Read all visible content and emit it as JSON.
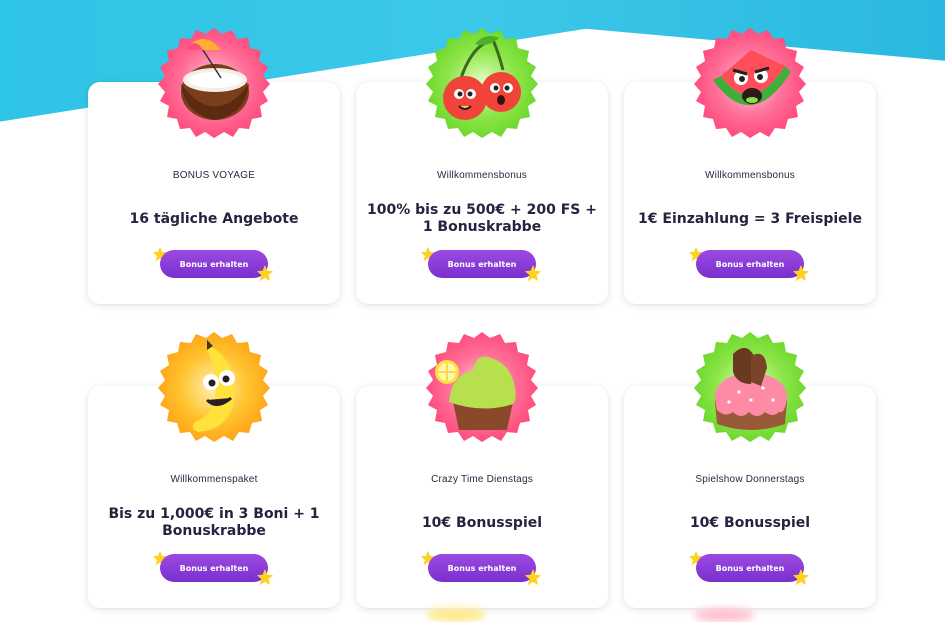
{
  "colors": {
    "sky": "#2ec4e6",
    "button": "#8a3cd8",
    "title_text": "#2a2140",
    "star": "#ffd21f",
    "badge_pink": "#ff5b8a",
    "badge_green": "#7ee23a",
    "badge_orange": "#ffb020"
  },
  "cards": [
    {
      "subtitle": "BONUS VOYAGE",
      "title": "16 tägliche Angebote",
      "button": "Bonus erhalten",
      "icon": "coconut-icon",
      "badge": "pink"
    },
    {
      "subtitle": "Willkommensbonus",
      "title": "100% bis zu 500€ + 200 FS + 1 Bonuskrabbe",
      "button": "Bonus erhalten",
      "icon": "cherries-icon",
      "badge": "green"
    },
    {
      "subtitle": "Willkommensbonus",
      "title": "1€ Einzahlung = 3 Freispiele",
      "button": "Bonus erhalten",
      "icon": "watermelon-icon",
      "badge": "pink"
    },
    {
      "subtitle": "Willkommenspaket",
      "title": "Bis zu 1,000€ in 3 Boni + 1 Bonuskrabbe",
      "button": "Bonus erhalten",
      "icon": "banana-icon",
      "badge": "orange"
    },
    {
      "subtitle": "Crazy Time Dienstags",
      "title": "10€ Bonusspiel",
      "button": "Bonus erhalten",
      "icon": "cupcake-icon",
      "badge": "pink"
    },
    {
      "subtitle": "Spielshow Donnerstags",
      "title": "10€ Bonusspiel",
      "button": "Bonus erhalten",
      "icon": "donut-icon",
      "badge": "green"
    }
  ]
}
